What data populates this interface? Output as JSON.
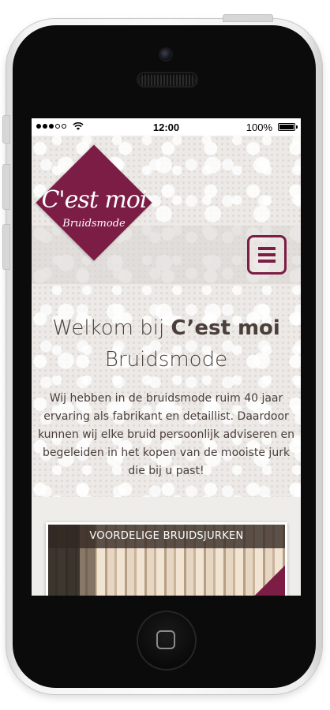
{
  "status_bar": {
    "time": "12:00",
    "battery": "100%",
    "signal_icon": "signal-dots-icon",
    "wifi_icon": "wifi-icon"
  },
  "brand": {
    "name": "C'est moi",
    "subtitle": "Bruidsmode",
    "color": "#7c1d46"
  },
  "nav": {
    "menu_icon": "hamburger-menu-icon"
  },
  "welcome": {
    "prefix": "Welkom bij ",
    "name": "C’est moi",
    "suffix": "Bruidsmode"
  },
  "intro": "Wij hebben in de bruidsmode ruim 40 jaar ervaring als fabrikant en detaillist. Daardoor kunnen wij elke bruid persoonlijk adviseren en begeleiden in het kopen van de mooiste jurk die bij u past!",
  "card": {
    "caption": "VOORDELIGE BRUIDSJURKEN"
  }
}
